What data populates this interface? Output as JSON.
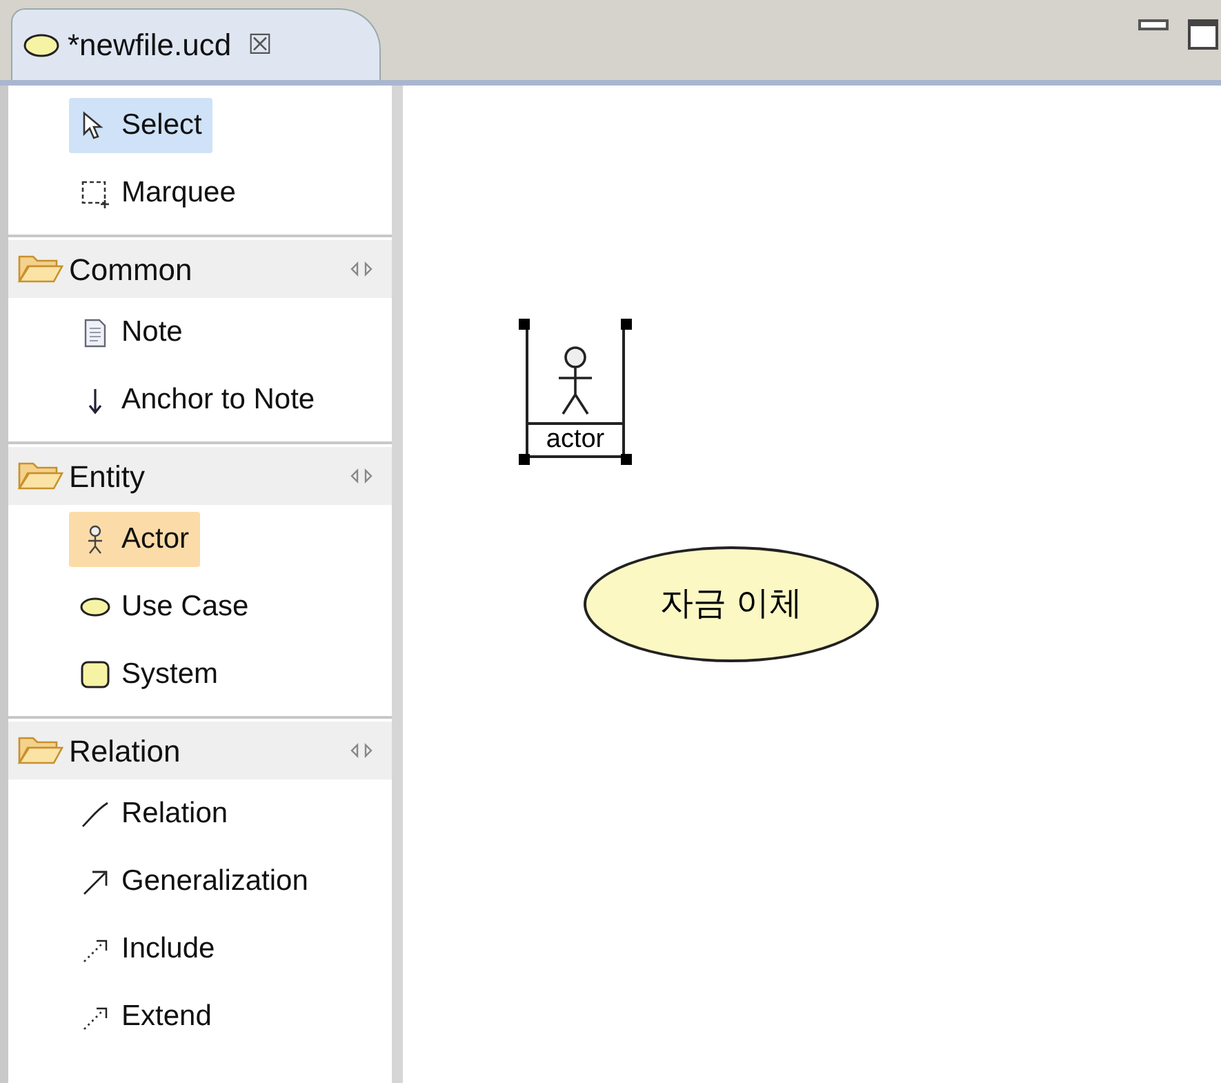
{
  "tab": {
    "title": "*newfile.ucd",
    "close": "☒"
  },
  "palette": {
    "tools": [
      {
        "label": "Select",
        "kind": "select",
        "selected": true,
        "hovered": false
      },
      {
        "label": "Marquee",
        "kind": "marquee",
        "selected": false,
        "hovered": false
      }
    ],
    "groups": [
      {
        "label": "Common",
        "items": [
          {
            "label": "Note",
            "kind": "note",
            "selected": false,
            "hovered": false
          },
          {
            "label": "Anchor to Note",
            "kind": "anchor",
            "selected": false,
            "hovered": false
          }
        ]
      },
      {
        "label": "Entity",
        "items": [
          {
            "label": "Actor",
            "kind": "actor",
            "selected": false,
            "hovered": true
          },
          {
            "label": "Use Case",
            "kind": "usecase",
            "selected": false,
            "hovered": false
          },
          {
            "label": "System",
            "kind": "system",
            "selected": false,
            "hovered": false
          }
        ]
      },
      {
        "label": "Relation",
        "items": [
          {
            "label": "Relation",
            "kind": "relation",
            "selected": false,
            "hovered": false
          },
          {
            "label": "Generalization",
            "kind": "generalization",
            "selected": false,
            "hovered": false
          },
          {
            "label": "Include",
            "kind": "include",
            "selected": false,
            "hovered": false
          },
          {
            "label": "Extend",
            "kind": "extend",
            "selected": false,
            "hovered": false
          }
        ]
      }
    ]
  },
  "canvas": {
    "nodes": [
      {
        "kind": "actor",
        "label": "actor",
        "selected": true
      },
      {
        "kind": "usecase",
        "label": "자금 이체",
        "selected": false
      }
    ]
  }
}
